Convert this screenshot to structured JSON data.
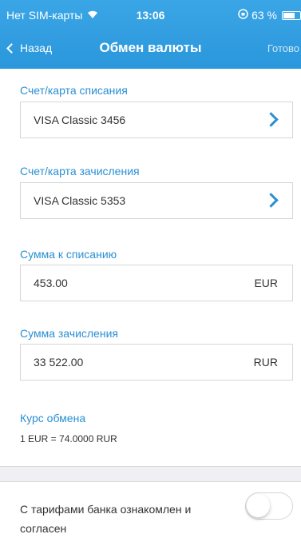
{
  "status_bar": {
    "carrier": "Нет SIM-карты",
    "time": "13:06",
    "battery": "63 %",
    "battery_level": 0.63
  },
  "nav": {
    "back_label": "Назад",
    "title": "Обмен валюты",
    "done_label": "Готово"
  },
  "form": {
    "debit_label": "Счет/карта списания",
    "debit_value": "VISA Classic 3456",
    "credit_label": "Счет/карта зачисления",
    "credit_value": "VISA Classic 5353",
    "debit_amount_label": "Сумма к списанию",
    "debit_amount_value": "453.00",
    "debit_amount_currency": "EUR",
    "credit_amount_label": "Сумма зачисления",
    "credit_amount_value": "33 522.00",
    "credit_amount_currency": "RUR",
    "rate_label": "Курс обмена",
    "rate_value": "1 EUR = 74.0000 RUR"
  },
  "agreement": {
    "text": "С тарифами банка ознакомлен и согласен",
    "toggle_on": false
  },
  "colors": {
    "accent": "#2a8fd4",
    "header": "#3aa6e6"
  }
}
